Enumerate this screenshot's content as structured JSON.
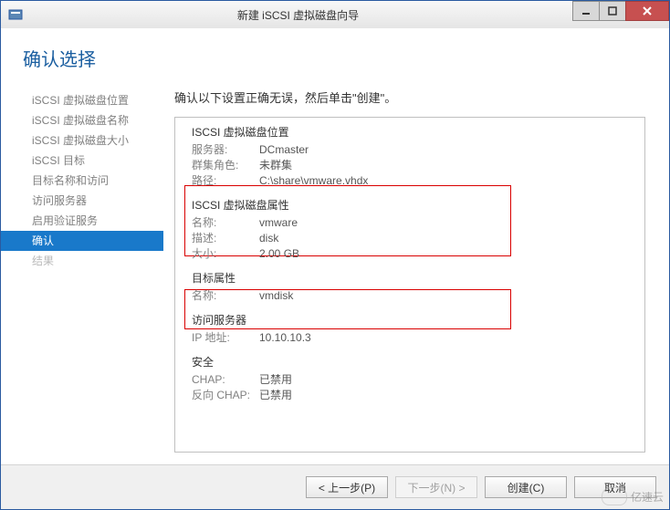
{
  "window": {
    "title": "新建 iSCSI 虚拟磁盘向导"
  },
  "wizard": {
    "heading": "确认选择",
    "hint": "确认以下设置正确无误，然后单击\"创建\"。"
  },
  "sidebar": {
    "items": [
      {
        "label": "iSCSI 虚拟磁盘位置",
        "state": "done"
      },
      {
        "label": "iSCSI 虚拟磁盘名称",
        "state": "done"
      },
      {
        "label": "iSCSI 虚拟磁盘大小",
        "state": "done"
      },
      {
        "label": "iSCSI 目标",
        "state": "done"
      },
      {
        "label": "目标名称和访问",
        "state": "done"
      },
      {
        "label": "访问服务器",
        "state": "done"
      },
      {
        "label": "启用验证服务",
        "state": "done"
      },
      {
        "label": "确认",
        "state": "active"
      },
      {
        "label": "结果",
        "state": "disabled"
      }
    ]
  },
  "details": {
    "location": {
      "title": "ISCSI 虚拟磁盘位置",
      "server_label": "服务器:",
      "server_value": "DCmaster",
      "cluster_label": "群集角色:",
      "cluster_value": "未群集",
      "path_label": "路径:",
      "path_value": "C:\\share\\vmware.vhdx"
    },
    "props": {
      "title": "ISCSI 虚拟磁盘属性",
      "name_label": "名称:",
      "name_value": "vmware",
      "desc_label": "描述:",
      "desc_value": "disk",
      "size_label": "大小:",
      "size_value": "2.00 GB"
    },
    "target": {
      "title": "目标属性",
      "name_label": "名称:",
      "name_value": "vmdisk"
    },
    "access": {
      "title": "访问服务器",
      "ip_label": "IP 地址:",
      "ip_value": "10.10.10.3"
    },
    "security": {
      "title": "安全",
      "chap_label": "CHAP:",
      "chap_value": "已禁用",
      "rchap_label": "反向 CHAP:",
      "rchap_value": "已禁用"
    }
  },
  "buttons": {
    "prev": "< 上一步(P)",
    "next": "下一步(N) >",
    "create": "创建(C)",
    "cancel": "取消"
  },
  "watermark": {
    "text": "亿速云"
  }
}
